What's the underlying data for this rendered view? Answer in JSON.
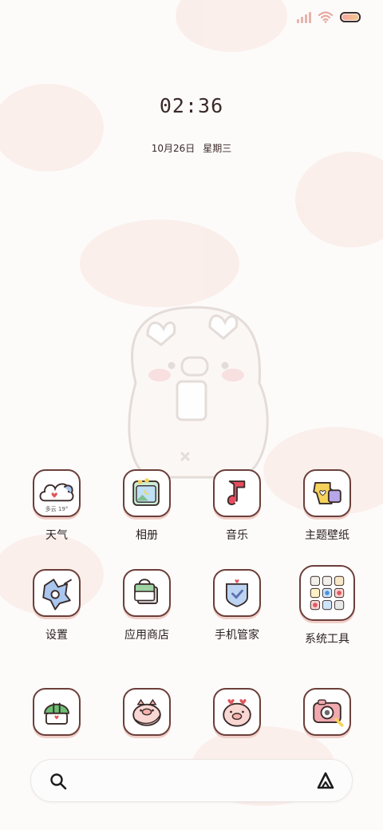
{
  "status_bar": {
    "signal_icon": "cellular-signal-icon",
    "wifi_icon": "wifi-icon",
    "battery_icon": "battery-icon",
    "battery_colors": [
      "#f6a6a0",
      "#f4c58b"
    ]
  },
  "clock": {
    "time": "02:36",
    "date": "10月26日",
    "weekday": "星期三"
  },
  "wallpaper": {
    "theme": "pig-wallpaper",
    "accent": "#f7ebe5"
  },
  "apps_row1": [
    {
      "label": "天气",
      "icon": "weather-icon",
      "weather_text": "多云 19°"
    },
    {
      "label": "相册",
      "icon": "gallery-icon"
    },
    {
      "label": "音乐",
      "icon": "music-icon"
    },
    {
      "label": "主题壁纸",
      "icon": "themes-icon"
    }
  ],
  "apps_row2": [
    {
      "label": "设置",
      "icon": "settings-icon"
    },
    {
      "label": "应用商店",
      "icon": "app-store-icon"
    },
    {
      "label": "手机管家",
      "icon": "security-icon"
    },
    {
      "label": "系统工具",
      "icon": "system-tools-folder-icon"
    }
  ],
  "dock": [
    {
      "icon": "phone-icon"
    },
    {
      "icon": "messages-icon"
    },
    {
      "icon": "browser-icon"
    },
    {
      "icon": "camera-icon"
    }
  ],
  "search_bar": {
    "search_icon": "search-icon",
    "assistant_icon": "assistant-icon"
  }
}
